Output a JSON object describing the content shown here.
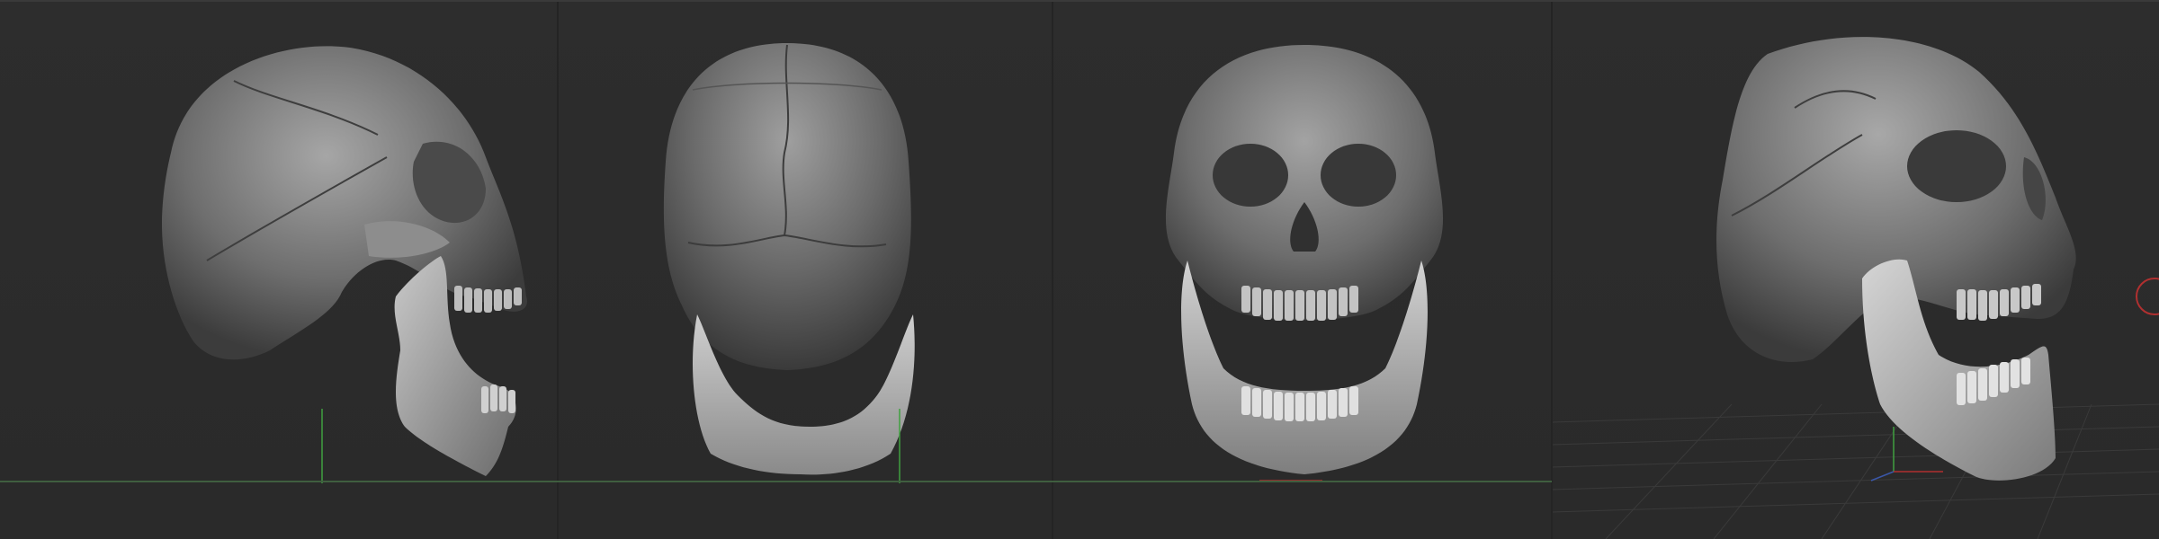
{
  "viewports": [
    {
      "id": "left",
      "icon": "skull-side-view-icon"
    },
    {
      "id": "back",
      "icon": "skull-back-view-icon"
    },
    {
      "id": "front",
      "icon": "skull-front-view-icon"
    },
    {
      "id": "perspective",
      "icon": "skull-perspective-view-icon"
    }
  ],
  "colors": {
    "background": "#2b2b2b",
    "model_light": "#9a9a9a",
    "model_dark": "#3a3a3a",
    "gizmo_green": "#3fa03f",
    "gizmo_red": "#b03030",
    "cursor_ring": "#b03030"
  }
}
